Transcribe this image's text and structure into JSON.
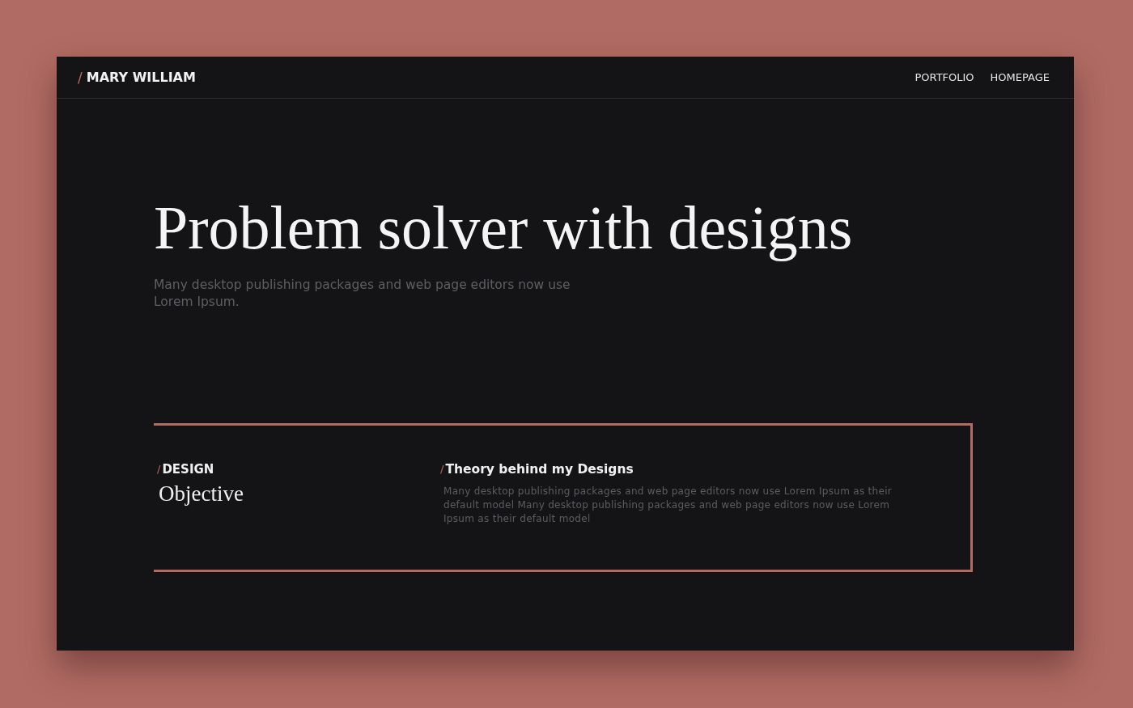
{
  "header": {
    "slash": "/",
    "brand": "MARY WILLIAM",
    "nav": [
      {
        "label": "PORTFOLIO"
      },
      {
        "label": "HOMEPAGE"
      }
    ]
  },
  "hero": {
    "title": "Problem solver with designs",
    "subtitle": "Many desktop publishing packages and web page editors now use Lorem Ipsum."
  },
  "card": {
    "left": {
      "slash": "/",
      "eyebrow": "DESIGN",
      "title": "Objective"
    },
    "right": {
      "slash": "/",
      "heading": "Theory behind my Designs",
      "body": "Many desktop publishing packages and web page editors now use Lorem Ipsum as their default model Many desktop publishing packages and web page editors now use Lorem Ipsum as their default model"
    }
  }
}
